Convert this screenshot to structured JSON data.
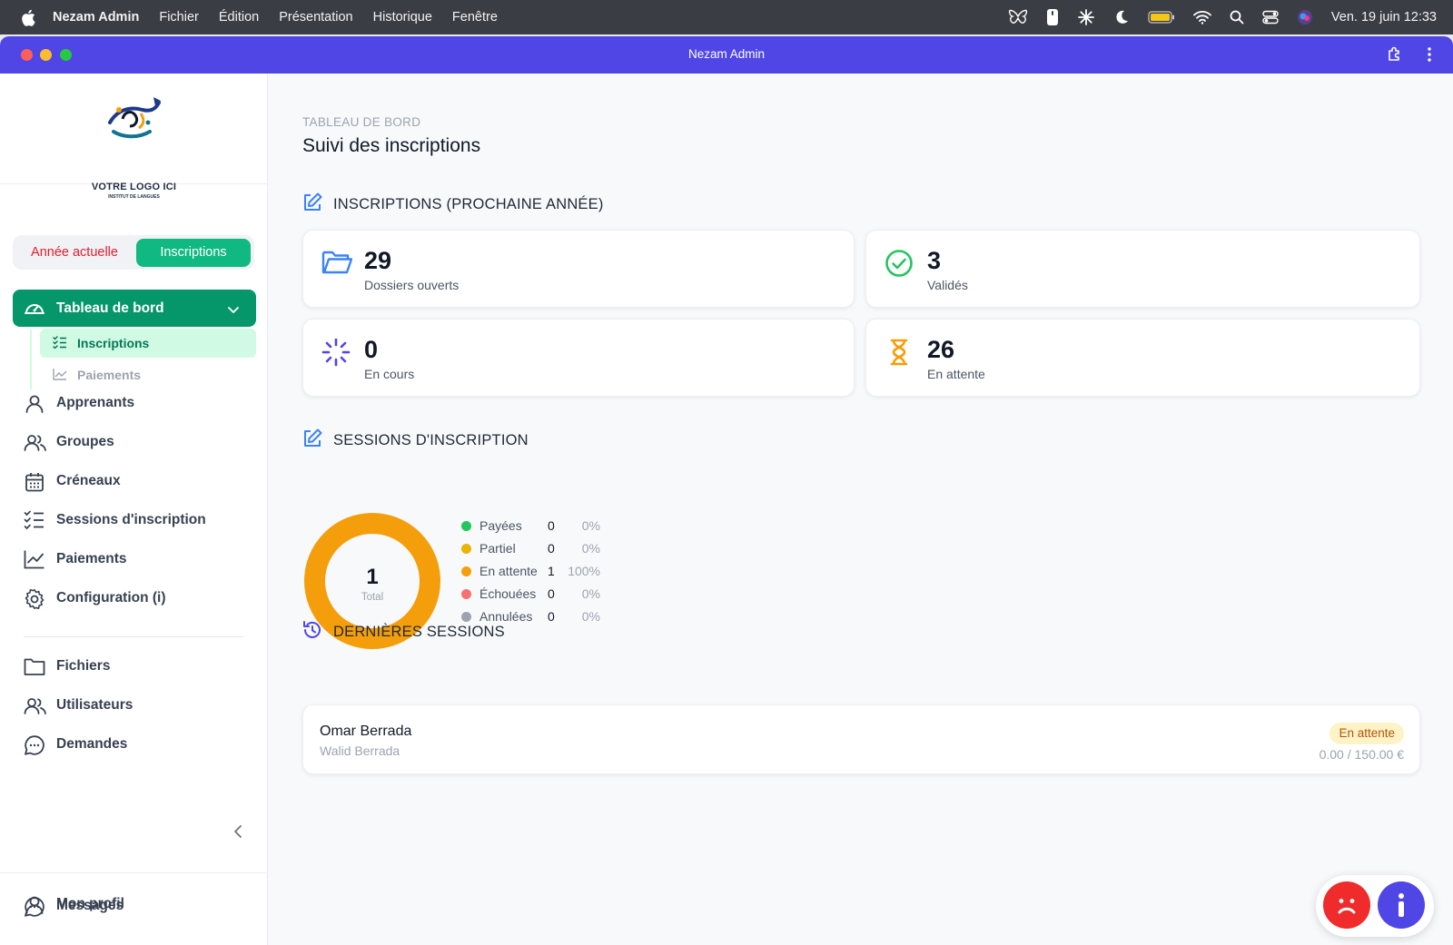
{
  "menubar": {
    "app_name": "Nezam Admin",
    "menus": [
      "Fichier",
      "Édition",
      "Présentation",
      "Historique",
      "Fenêtre"
    ],
    "clock": "Ven. 19 juin  12:33"
  },
  "window": {
    "title": "Nezam Admin"
  },
  "sidebar": {
    "logo_text": "VOTRE LOGO ICI",
    "logo_subtext": "INSTITUT DE LANGUES",
    "toggle": {
      "current_year": "Année actuelle",
      "registrations": "Inscriptions"
    },
    "dashboard": {
      "label": "Tableau de bord",
      "children": [
        {
          "label": "Inscriptions"
        },
        {
          "label": "Paiements"
        }
      ]
    },
    "items": [
      {
        "label": "Apprenants",
        "icon": "user-icon"
      },
      {
        "label": "Groupes",
        "icon": "users-icon"
      },
      {
        "label": "Créneaux",
        "icon": "calendar-icon"
      },
      {
        "label": "Sessions d'inscription",
        "icon": "checklist-icon"
      },
      {
        "label": "Paiements",
        "icon": "chart-line-icon"
      },
      {
        "label": "Configuration (i)",
        "icon": "gear-icon"
      }
    ],
    "items2": [
      {
        "label": "Fichiers",
        "icon": "folder-icon"
      },
      {
        "label": "Utilisateurs",
        "icon": "users-icon"
      },
      {
        "label": "Demandes",
        "icon": "chat-icon"
      }
    ],
    "bottom": [
      {
        "label": "Mon profil",
        "icon": "user-icon"
      },
      {
        "label": "Messages",
        "icon": "chat-icon"
      }
    ]
  },
  "main": {
    "breadcrumb": "TABLEAU DE BORD",
    "title": "Suivi des inscriptions",
    "section_registrations": "INSCRIPTIONS (PROCHAINE ANNÉE)",
    "stats": [
      {
        "value": "29",
        "label": "Dossiers ouverts",
        "color": "#3b82f6"
      },
      {
        "value": "3",
        "label": "Validés",
        "color": "#22c55e"
      },
      {
        "value": "0",
        "label": "En cours",
        "color": "#4f46e5"
      },
      {
        "value": "26",
        "label": "En attente",
        "color": "#f59e0b"
      }
    ],
    "section_sessions": "SESSIONS D'INSCRIPTION",
    "donut": {
      "total": "1",
      "total_label": "Total"
    },
    "legend": [
      {
        "name": "Payées",
        "count": "0",
        "pct": "0%",
        "color": "#22c55e"
      },
      {
        "name": "Partiel",
        "count": "0",
        "pct": "0%",
        "color": "#eab308"
      },
      {
        "name": "En attente",
        "count": "1",
        "pct": "100%",
        "color": "#f59e0b"
      },
      {
        "name": "Échouées",
        "count": "0",
        "pct": "0%",
        "color": "#f87171"
      },
      {
        "name": "Annulées",
        "count": "0",
        "pct": "0%",
        "color": "#9ca3af"
      }
    ],
    "section_latest": "DERNIÈRES SESSIONS",
    "latest": [
      {
        "name": "Omar Berrada",
        "sub": "Walid Berrada",
        "status": "En attente",
        "amount": "0.00 / 150.00 €"
      }
    ]
  },
  "chart_data": {
    "type": "pie",
    "categories": [
      "Payées",
      "Partiel",
      "En attente",
      "Échouées",
      "Annulées"
    ],
    "values": [
      0,
      0,
      1,
      0,
      0
    ],
    "title": "",
    "colors": [
      "#22c55e",
      "#eab308",
      "#f59e0b",
      "#f87171",
      "#9ca3af"
    ]
  }
}
